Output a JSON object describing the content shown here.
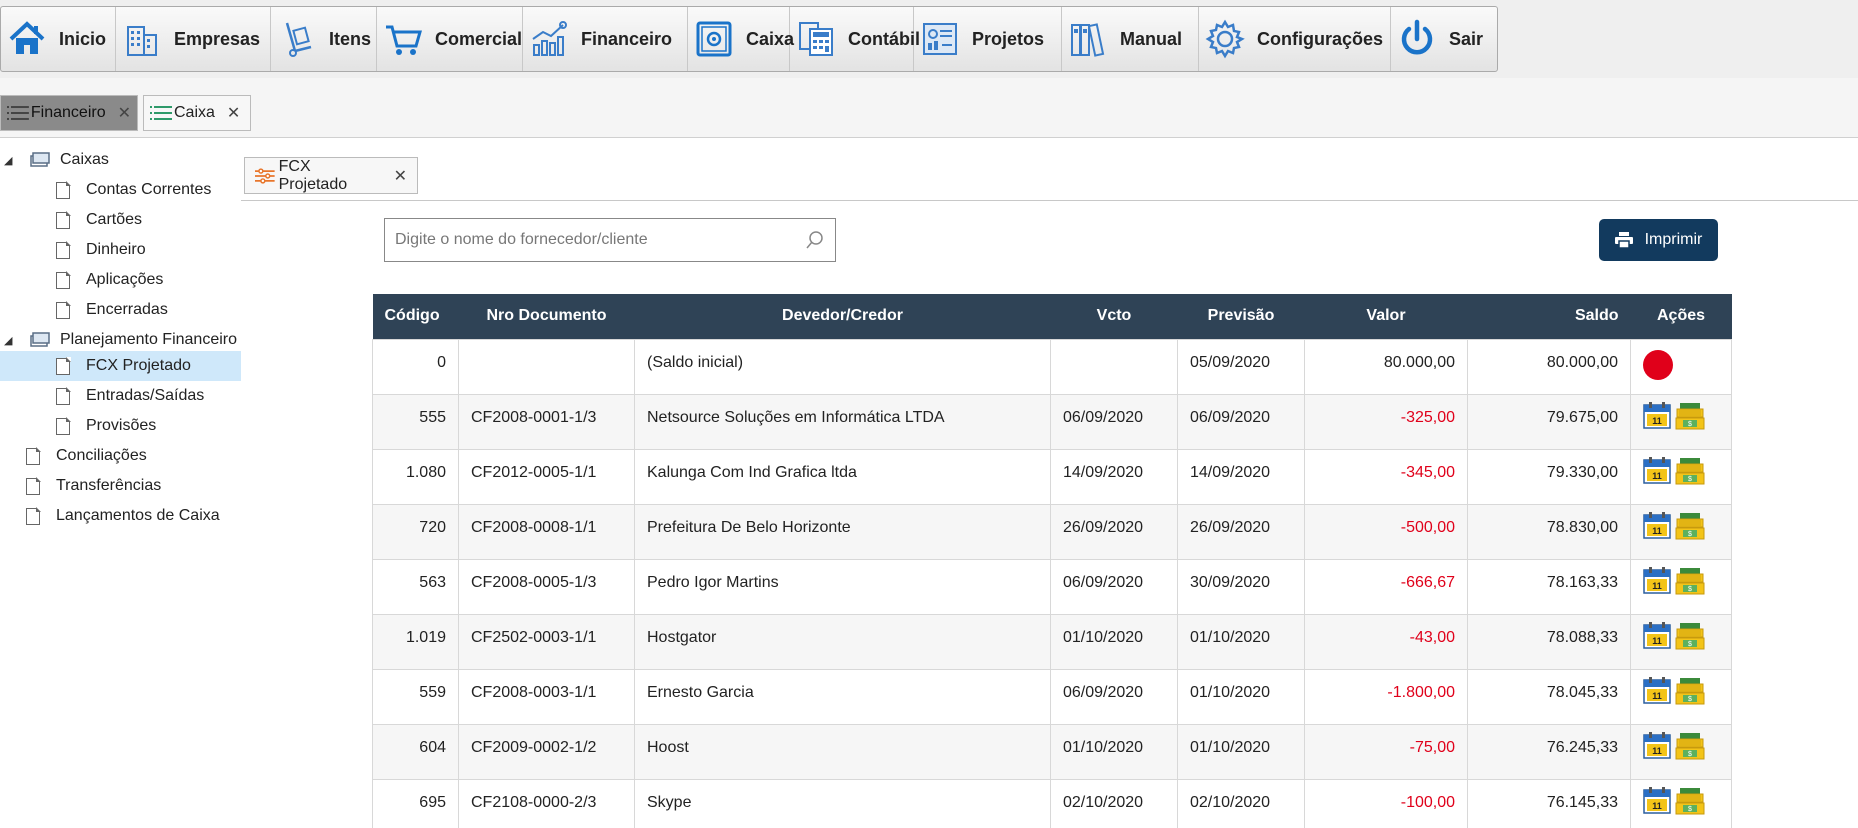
{
  "topbar": {
    "items": [
      {
        "label": "Inicio",
        "icon": "home-icon"
      },
      {
        "label": "Empresas",
        "icon": "building-icon"
      },
      {
        "label": "Itens",
        "icon": "hand-truck-icon"
      },
      {
        "label": "Comercial",
        "icon": "cart-icon"
      },
      {
        "label": "Financeiro",
        "icon": "chart-growth-icon"
      },
      {
        "label": "Caixa",
        "icon": "safe-icon"
      },
      {
        "label": "Contábil",
        "icon": "calculator-icon"
      },
      {
        "label": "Projetos",
        "icon": "dashboard-icon"
      },
      {
        "label": "Manual",
        "icon": "binders-icon"
      },
      {
        "label": "Configurações",
        "icon": "gear-icon"
      },
      {
        "label": "Sair",
        "icon": "power-icon"
      }
    ]
  },
  "tabs1": [
    {
      "label": "Financeiro",
      "close": "✕"
    },
    {
      "label": "Caixa",
      "close": "✕"
    }
  ],
  "tree": {
    "caixas": "Caixas",
    "contas_correntes": "Contas Correntes",
    "cartoes": "Cartões",
    "dinheiro": "Dinheiro",
    "aplicacoes": "Aplicações",
    "encerradas": "Encerradas",
    "planejamento": "Planejamento Financeiro",
    "fcx_projetado": "FCX Projetado",
    "entradas_saidas": "Entradas/Saídas",
    "provisoes": "Provisões",
    "conciliacoes": "Conciliações",
    "transferencias": "Transferências",
    "lancamentos": "Lançamentos de Caixa"
  },
  "tab2": {
    "label": "FCX Projetado",
    "close": "✕"
  },
  "search": {
    "placeholder": "Digite o nome do fornecedor/cliente",
    "value": ""
  },
  "print_button": {
    "label": "Imprimir"
  },
  "colors": {
    "header": "#2f4356",
    "negative": "#e0001a",
    "button": "#123a5e",
    "selected": "#cfe8fa"
  },
  "table": {
    "headers": {
      "codigo": "Código",
      "nro_documento": "Nro Documento",
      "devedor_credor": "Devedor/Credor",
      "vcto": "Vcto",
      "previsao": "Previsão",
      "valor": "Valor",
      "saldo": "Saldo",
      "acoes": "Ações"
    },
    "rows": [
      {
        "codigo": "0",
        "nro": "",
        "devedor": "(Saldo inicial)",
        "vcto": "",
        "previsao": "05/09/2020",
        "valor": "80.000,00",
        "saldo": "80.000,00",
        "negative": false,
        "action": "red-dot"
      },
      {
        "codigo": "555",
        "nro": "CF2008-0001-1/3",
        "devedor": "Netsource Soluções em Informática LTDA",
        "vcto": "06/09/2020",
        "previsao": "06/09/2020",
        "valor": "-325,00",
        "saldo": "79.675,00",
        "negative": true,
        "action": "icons"
      },
      {
        "codigo": "1.080",
        "nro": "CF2012-0005-1/1",
        "devedor": "Kalunga Com Ind Grafica ltda",
        "vcto": "14/09/2020",
        "previsao": "14/09/2020",
        "valor": "-345,00",
        "saldo": "79.330,00",
        "negative": true,
        "action": "icons"
      },
      {
        "codigo": "720",
        "nro": "CF2008-0008-1/1",
        "devedor": "Prefeitura De Belo Horizonte",
        "vcto": "26/09/2020",
        "previsao": "26/09/2020",
        "valor": "-500,00",
        "saldo": "78.830,00",
        "negative": true,
        "action": "icons"
      },
      {
        "codigo": "563",
        "nro": "CF2008-0005-1/3",
        "devedor": "Pedro Igor Martins",
        "vcto": "06/09/2020",
        "previsao": "30/09/2020",
        "valor": "-666,67",
        "saldo": "78.163,33",
        "negative": true,
        "action": "icons"
      },
      {
        "codigo": "1.019",
        "nro": "CF2502-0003-1/1",
        "devedor": "Hostgator",
        "vcto": "01/10/2020",
        "previsao": "01/10/2020",
        "valor": "-43,00",
        "saldo": "78.088,33",
        "negative": true,
        "action": "icons"
      },
      {
        "codigo": "559",
        "nro": "CF2008-0003-1/1",
        "devedor": "Ernesto Garcia",
        "vcto": "06/09/2020",
        "previsao": "01/10/2020",
        "valor": "-1.800,00",
        "saldo": "78.045,33",
        "negative": true,
        "action": "icons"
      },
      {
        "codigo": "604",
        "nro": "CF2009-0002-1/2",
        "devedor": "Hoost",
        "vcto": "01/10/2020",
        "previsao": "01/10/2020",
        "valor": "-75,00",
        "saldo": "76.245,33",
        "negative": true,
        "action": "icons"
      },
      {
        "codigo": "695",
        "nro": "CF2108-0000-2/3",
        "devedor": "Skype",
        "vcto": "02/10/2020",
        "previsao": "02/10/2020",
        "valor": "-100,00",
        "saldo": "76.145,33",
        "negative": true,
        "action": "icons"
      }
    ]
  },
  "calendar_icon_day": "11"
}
